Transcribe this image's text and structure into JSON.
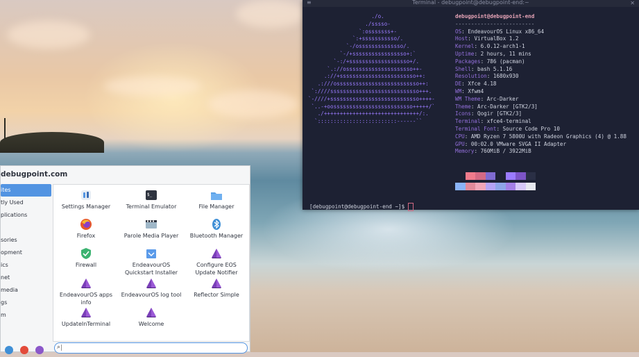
{
  "terminal": {
    "title": "Terminal - debugpoint@debugpoint-end:~",
    "close_glyph": "✕",
    "menu_glyph": "≡",
    "neofetch": {
      "user_host": "debugpoint@debugpoint-end",
      "separator": "-------------------------",
      "lines": [
        {
          "key": "OS",
          "value": "EndeavourOS Linux x86_64"
        },
        {
          "key": "Host",
          "value": "VirtualBox 1.2"
        },
        {
          "key": "Kernel",
          "value": "6.0.12-arch1-1"
        },
        {
          "key": "Uptime",
          "value": "2 hours, 11 mins"
        },
        {
          "key": "Packages",
          "value": "786 (pacman)"
        },
        {
          "key": "Shell",
          "value": "bash 5.1.16"
        },
        {
          "key": "Resolution",
          "value": "1680x930"
        },
        {
          "key": "DE",
          "value": "Xfce 4.18"
        },
        {
          "key": "WM",
          "value": "Xfwm4"
        },
        {
          "key": "WM Theme",
          "value": "Arc-Darker"
        },
        {
          "key": "Theme",
          "value": "Arc-Darker [GTK2/3]"
        },
        {
          "key": "Icons",
          "value": "Qogir [GTK2/3]"
        },
        {
          "key": "Terminal",
          "value": "xfce4-terminal"
        },
        {
          "key": "Terminal Font",
          "value": "Source Code Pro 10"
        },
        {
          "key": "CPU",
          "value": "AMD Ryzen 7 5800U with Radeon Graphics (4) @ 1.88"
        },
        {
          "key": "GPU",
          "value": "00:02.0 VMware SVGA II Adapter"
        },
        {
          "key": "Memory",
          "value": "760MiB / 3922MiB"
        }
      ],
      "swatch_colors_top": [
        "#1d2133",
        "#f07b8c",
        "#d46a84",
        "#7f6bd1",
        "#1d2133",
        "#9b7bff",
        "#7d55c7",
        "#2a2f45"
      ],
      "swatch_colors_bottom": [
        "#8ab4f8",
        "#e38a9a",
        "#f2a6b8",
        "#b5a3f5",
        "#8ea5e8",
        "#a47fe6",
        "#d6c8f8",
        "#e6e8ee"
      ]
    },
    "prompt": "[debugpoint@debugpoint-end ~]$ "
  },
  "menu": {
    "title": "debugpoint.com",
    "categories": [
      {
        "label": "ites",
        "selected": true
      },
      {
        "label": "tly Used",
        "selected": false
      },
      {
        "label": "plications",
        "selected": false
      },
      {
        "label": "",
        "selected": false
      },
      {
        "label": "sories",
        "selected": false
      },
      {
        "label": "opment",
        "selected": false
      },
      {
        "label": "ics",
        "selected": false
      },
      {
        "label": "net",
        "selected": false
      },
      {
        "label": "media",
        "selected": false
      },
      {
        "label": "gs",
        "selected": false
      },
      {
        "label": "m",
        "selected": false
      }
    ],
    "apps": [
      {
        "label": "Settings Manager",
        "icon": "settings-manager-icon"
      },
      {
        "label": "Terminal Emulator",
        "icon": "terminal-icon"
      },
      {
        "label": "File Manager",
        "icon": "folder-icon"
      },
      {
        "label": "Firefox",
        "icon": "firefox-icon"
      },
      {
        "label": "Parole Media Player",
        "icon": "media-player-icon"
      },
      {
        "label": "Bluetooth Manager",
        "icon": "bluetooth-icon"
      },
      {
        "label": "Firewall",
        "icon": "shield-icon"
      },
      {
        "label": "EndeavourOS\nQuickstart Installer",
        "icon": "installer-icon"
      },
      {
        "label": "Configure EOS\nUpdate Notifier",
        "icon": "endeavouros-icon"
      },
      {
        "label": "EndeavourOS apps\ninfo",
        "icon": "endeavouros-icon"
      },
      {
        "label": "EndeavourOS log tool",
        "icon": "endeavouros-icon"
      },
      {
        "label": "Reflector Simple",
        "icon": "endeavouros-icon"
      },
      {
        "label": "UpdateInTerminal",
        "icon": "endeavouros-icon"
      },
      {
        "label": "Welcome",
        "icon": "endeavouros-icon"
      }
    ],
    "search": {
      "value": "",
      "placeholder": ""
    },
    "bottom_icon_colors": [
      "#3f8fd6",
      "#e34b3a",
      "#8b57c9"
    ]
  }
}
